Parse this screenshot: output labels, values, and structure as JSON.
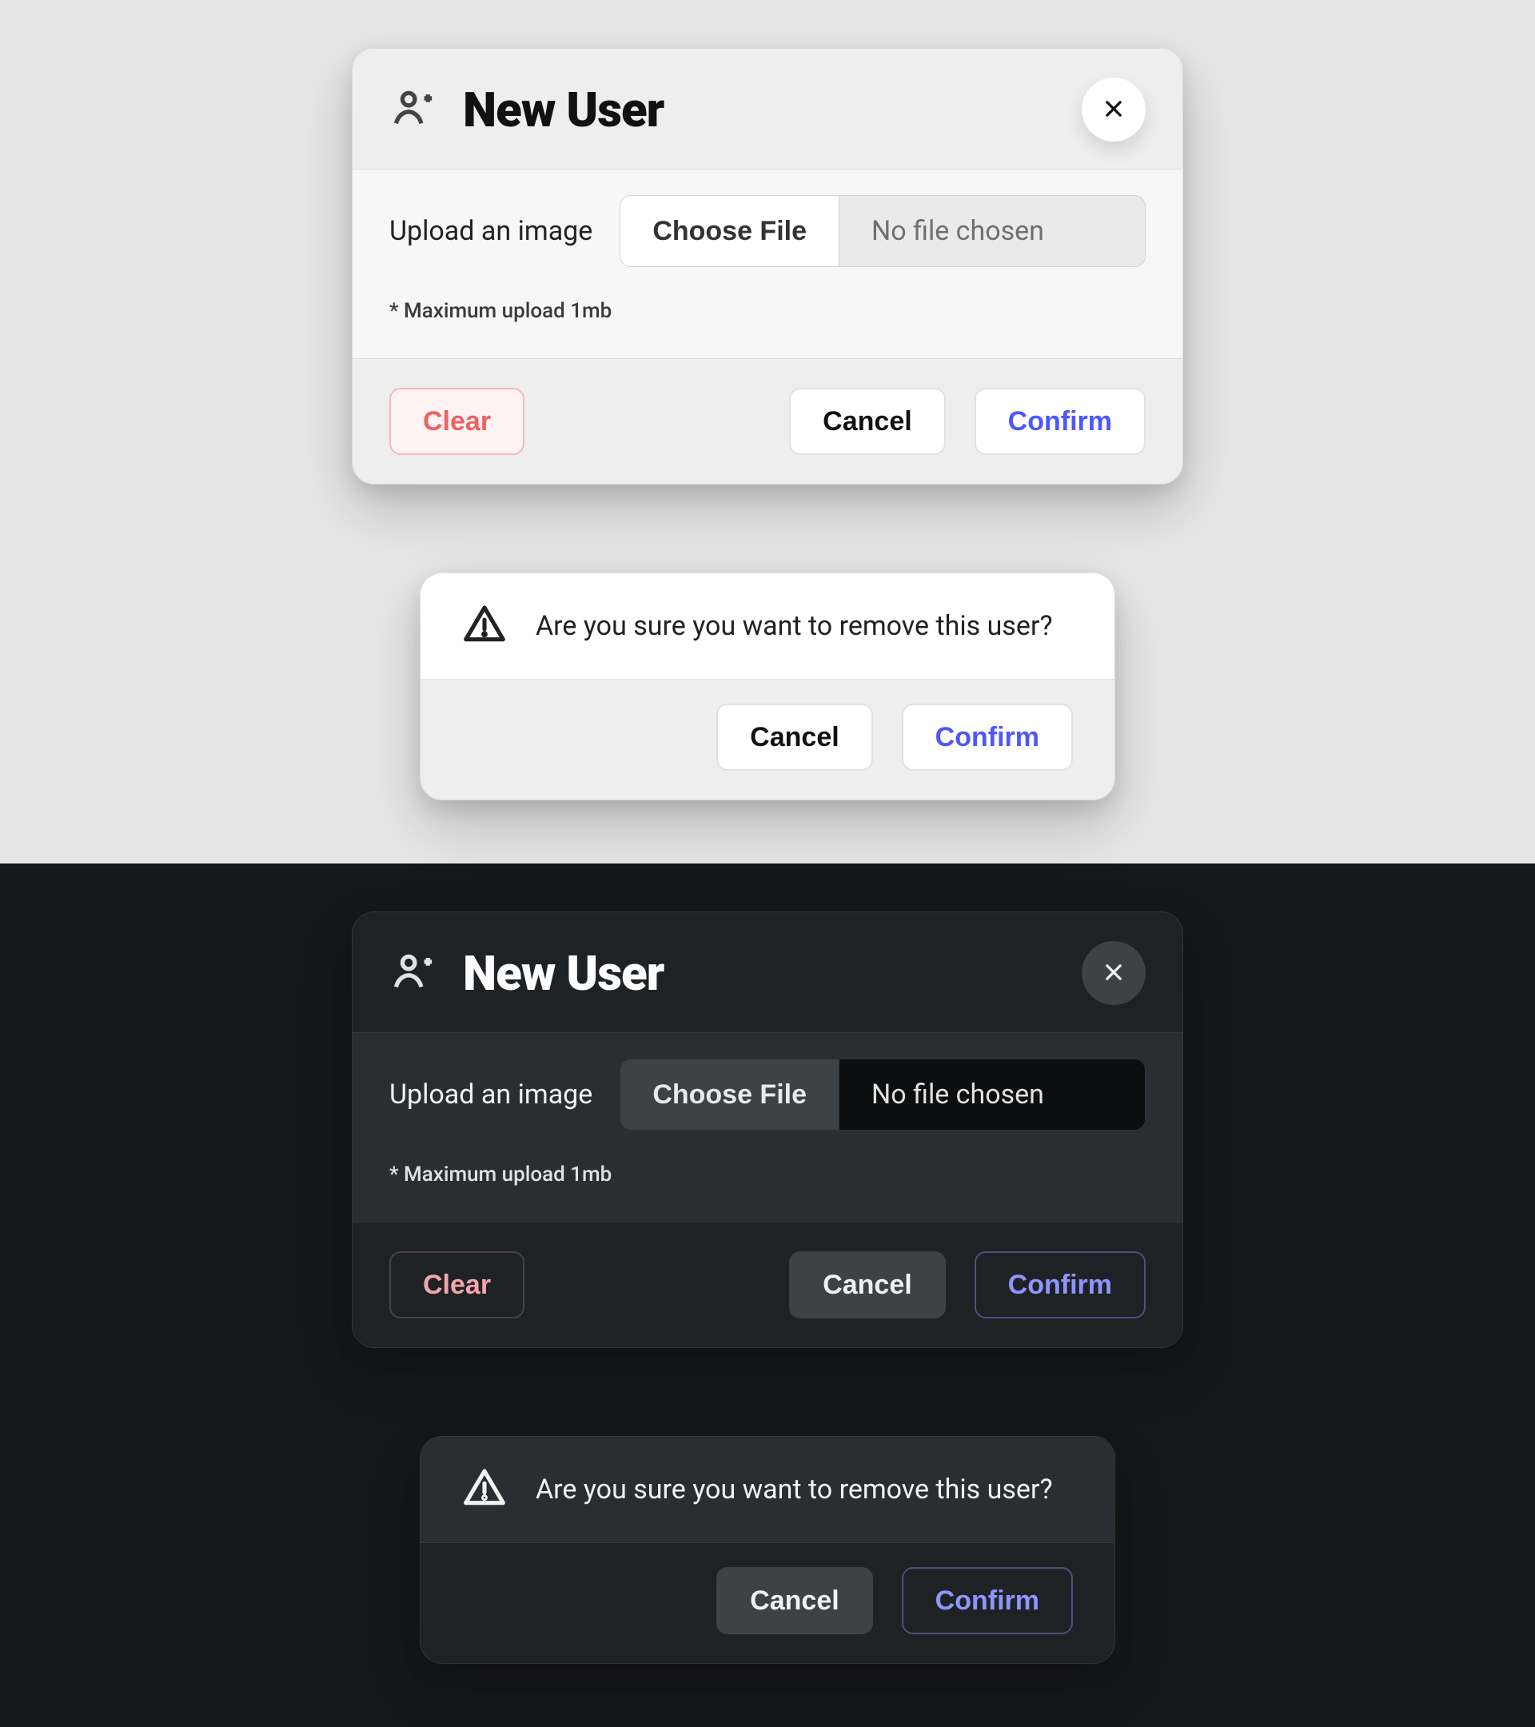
{
  "newUser": {
    "title": "New User",
    "uploadLabel": "Upload an image",
    "chooseFile": "Choose File",
    "fileStatus": "No file chosen",
    "hint": "* Maximum upload 1mb",
    "clear": "Clear",
    "cancel": "Cancel",
    "confirm": "Confirm"
  },
  "confirmDialog": {
    "message": "Are you sure you want to remove this user?",
    "cancel": "Cancel",
    "confirm": "Confirm"
  },
  "colors": {
    "light": {
      "accent": "#4c57ff",
      "danger": "#ef6262",
      "surface": "#eeeeee",
      "surfaceAlt": "#f7f7f7"
    },
    "dark": {
      "accent": "#8f95ff",
      "danger": "#f4a6ad",
      "surface": "#1f2225",
      "surfaceAlt": "#2a2e32"
    }
  }
}
